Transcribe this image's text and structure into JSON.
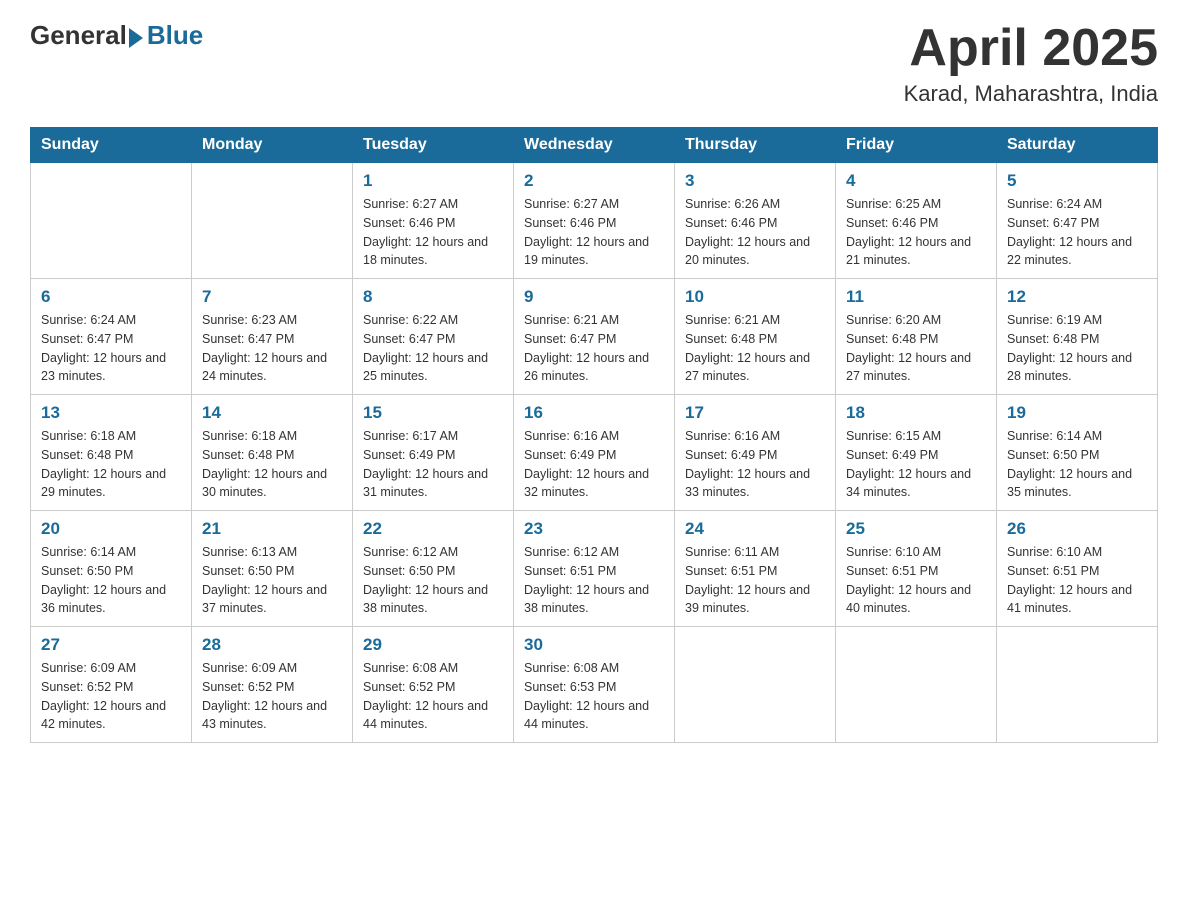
{
  "logo": {
    "general": "General",
    "blue": "Blue"
  },
  "header": {
    "month": "April 2025",
    "location": "Karad, Maharashtra, India"
  },
  "weekdays": [
    "Sunday",
    "Monday",
    "Tuesday",
    "Wednesday",
    "Thursday",
    "Friday",
    "Saturday"
  ],
  "weeks": [
    [
      {
        "day": "",
        "info": ""
      },
      {
        "day": "",
        "info": ""
      },
      {
        "day": "1",
        "info": "Sunrise: 6:27 AM\nSunset: 6:46 PM\nDaylight: 12 hours\nand 18 minutes."
      },
      {
        "day": "2",
        "info": "Sunrise: 6:27 AM\nSunset: 6:46 PM\nDaylight: 12 hours\nand 19 minutes."
      },
      {
        "day": "3",
        "info": "Sunrise: 6:26 AM\nSunset: 6:46 PM\nDaylight: 12 hours\nand 20 minutes."
      },
      {
        "day": "4",
        "info": "Sunrise: 6:25 AM\nSunset: 6:46 PM\nDaylight: 12 hours\nand 21 minutes."
      },
      {
        "day": "5",
        "info": "Sunrise: 6:24 AM\nSunset: 6:47 PM\nDaylight: 12 hours\nand 22 minutes."
      }
    ],
    [
      {
        "day": "6",
        "info": "Sunrise: 6:24 AM\nSunset: 6:47 PM\nDaylight: 12 hours\nand 23 minutes."
      },
      {
        "day": "7",
        "info": "Sunrise: 6:23 AM\nSunset: 6:47 PM\nDaylight: 12 hours\nand 24 minutes."
      },
      {
        "day": "8",
        "info": "Sunrise: 6:22 AM\nSunset: 6:47 PM\nDaylight: 12 hours\nand 25 minutes."
      },
      {
        "day": "9",
        "info": "Sunrise: 6:21 AM\nSunset: 6:47 PM\nDaylight: 12 hours\nand 26 minutes."
      },
      {
        "day": "10",
        "info": "Sunrise: 6:21 AM\nSunset: 6:48 PM\nDaylight: 12 hours\nand 27 minutes."
      },
      {
        "day": "11",
        "info": "Sunrise: 6:20 AM\nSunset: 6:48 PM\nDaylight: 12 hours\nand 27 minutes."
      },
      {
        "day": "12",
        "info": "Sunrise: 6:19 AM\nSunset: 6:48 PM\nDaylight: 12 hours\nand 28 minutes."
      }
    ],
    [
      {
        "day": "13",
        "info": "Sunrise: 6:18 AM\nSunset: 6:48 PM\nDaylight: 12 hours\nand 29 minutes."
      },
      {
        "day": "14",
        "info": "Sunrise: 6:18 AM\nSunset: 6:48 PM\nDaylight: 12 hours\nand 30 minutes."
      },
      {
        "day": "15",
        "info": "Sunrise: 6:17 AM\nSunset: 6:49 PM\nDaylight: 12 hours\nand 31 minutes."
      },
      {
        "day": "16",
        "info": "Sunrise: 6:16 AM\nSunset: 6:49 PM\nDaylight: 12 hours\nand 32 minutes."
      },
      {
        "day": "17",
        "info": "Sunrise: 6:16 AM\nSunset: 6:49 PM\nDaylight: 12 hours\nand 33 minutes."
      },
      {
        "day": "18",
        "info": "Sunrise: 6:15 AM\nSunset: 6:49 PM\nDaylight: 12 hours\nand 34 minutes."
      },
      {
        "day": "19",
        "info": "Sunrise: 6:14 AM\nSunset: 6:50 PM\nDaylight: 12 hours\nand 35 minutes."
      }
    ],
    [
      {
        "day": "20",
        "info": "Sunrise: 6:14 AM\nSunset: 6:50 PM\nDaylight: 12 hours\nand 36 minutes."
      },
      {
        "day": "21",
        "info": "Sunrise: 6:13 AM\nSunset: 6:50 PM\nDaylight: 12 hours\nand 37 minutes."
      },
      {
        "day": "22",
        "info": "Sunrise: 6:12 AM\nSunset: 6:50 PM\nDaylight: 12 hours\nand 38 minutes."
      },
      {
        "day": "23",
        "info": "Sunrise: 6:12 AM\nSunset: 6:51 PM\nDaylight: 12 hours\nand 38 minutes."
      },
      {
        "day": "24",
        "info": "Sunrise: 6:11 AM\nSunset: 6:51 PM\nDaylight: 12 hours\nand 39 minutes."
      },
      {
        "day": "25",
        "info": "Sunrise: 6:10 AM\nSunset: 6:51 PM\nDaylight: 12 hours\nand 40 minutes."
      },
      {
        "day": "26",
        "info": "Sunrise: 6:10 AM\nSunset: 6:51 PM\nDaylight: 12 hours\nand 41 minutes."
      }
    ],
    [
      {
        "day": "27",
        "info": "Sunrise: 6:09 AM\nSunset: 6:52 PM\nDaylight: 12 hours\nand 42 minutes."
      },
      {
        "day": "28",
        "info": "Sunrise: 6:09 AM\nSunset: 6:52 PM\nDaylight: 12 hours\nand 43 minutes."
      },
      {
        "day": "29",
        "info": "Sunrise: 6:08 AM\nSunset: 6:52 PM\nDaylight: 12 hours\nand 44 minutes."
      },
      {
        "day": "30",
        "info": "Sunrise: 6:08 AM\nSunset: 6:53 PM\nDaylight: 12 hours\nand 44 minutes."
      },
      {
        "day": "",
        "info": ""
      },
      {
        "day": "",
        "info": ""
      },
      {
        "day": "",
        "info": ""
      }
    ]
  ]
}
